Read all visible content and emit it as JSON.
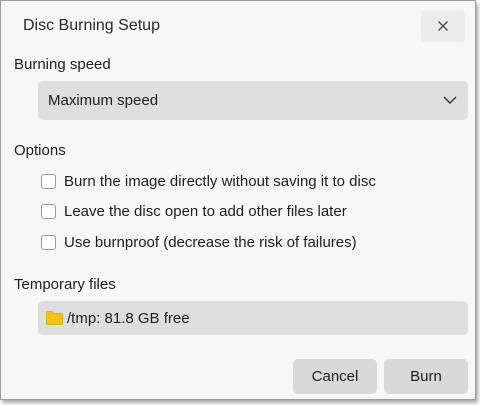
{
  "window": {
    "title": "Disc Burning Setup",
    "close_icon": "close-icon"
  },
  "burning_speed": {
    "label": "Burning speed",
    "selected": "Maximum speed",
    "icon": "chevron-down-icon"
  },
  "options": {
    "label": "Options",
    "items": [
      {
        "label": "Burn the image directly without saving it to disc",
        "checked": false
      },
      {
        "label": "Leave the disc open to add other files later",
        "checked": false
      },
      {
        "label": "Use burnproof (decrease the risk of failures)",
        "checked": false
      }
    ]
  },
  "temporary_files": {
    "label": "Temporary files",
    "value": "/tmp: 81.8 GB free",
    "icon": "folder-icon",
    "icon_color": "#f5c211"
  },
  "actions": {
    "cancel_label": "Cancel",
    "burn_label": "Burn"
  }
}
